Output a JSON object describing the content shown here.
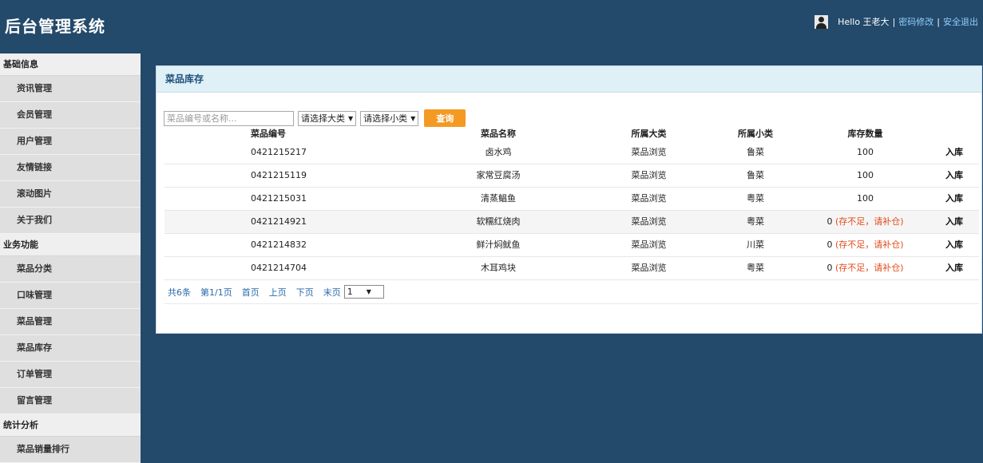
{
  "header": {
    "title": "后台管理系统",
    "greeting": "Hello 王老大",
    "separator": "|",
    "change_password": "密码修改",
    "logout": "安全退出"
  },
  "sidebar": {
    "groups": [
      {
        "label": "基础信息",
        "items": [
          "资讯管理",
          "会员管理",
          "用户管理",
          "友情链接",
          "滚动图片",
          "关于我们"
        ]
      },
      {
        "label": "业务功能",
        "items": [
          "菜品分类",
          "口味管理",
          "菜品管理",
          "菜品库存",
          "订单管理",
          "留言管理"
        ]
      },
      {
        "label": "统计分析",
        "items": [
          "菜品销量排行"
        ]
      }
    ]
  },
  "panel": {
    "title": "菜品库存",
    "search_placeholder": "菜品编号或名称...",
    "category_select": "请选择大类",
    "subcategory_select": "请选择小类",
    "query_button": "查询",
    "columns": [
      "菜品编号",
      "菜品名称",
      "所属大类",
      "所属小类",
      "库存数量"
    ],
    "rows": [
      {
        "code": "0421215217",
        "name": "卤水鸡",
        "category": "菜品浏览",
        "subcategory": "鲁菜",
        "qty": "100",
        "warning": "",
        "action": "入库"
      },
      {
        "code": "0421215119",
        "name": "家常豆腐汤",
        "category": "菜品浏览",
        "subcategory": "鲁菜",
        "qty": "100",
        "warning": "",
        "action": "入库"
      },
      {
        "code": "0421215031",
        "name": "清蒸鲳鱼",
        "category": "菜品浏览",
        "subcategory": "粤菜",
        "qty": "100",
        "warning": "",
        "action": "入库"
      },
      {
        "code": "0421214921",
        "name": "软糯红烧肉",
        "category": "菜品浏览",
        "subcategory": "粤菜",
        "qty": "0",
        "warning": "(存不足，请补仓)",
        "action": "入库"
      },
      {
        "code": "0421214832",
        "name": "鲜汁焖鱿鱼",
        "category": "菜品浏览",
        "subcategory": "川菜",
        "qty": "0",
        "warning": "(存不足，请补仓)",
        "action": "入库"
      },
      {
        "code": "0421214704",
        "name": "木耳鸡块",
        "category": "菜品浏览",
        "subcategory": "粤菜",
        "qty": "0",
        "warning": "(存不足，请补仓)",
        "action": "入库"
      }
    ],
    "pager": {
      "total": "共6条",
      "page_info": "第1/1页",
      "first": "首页",
      "prev": "上页",
      "next": "下页",
      "last": "末页",
      "current_page": "1"
    }
  }
}
